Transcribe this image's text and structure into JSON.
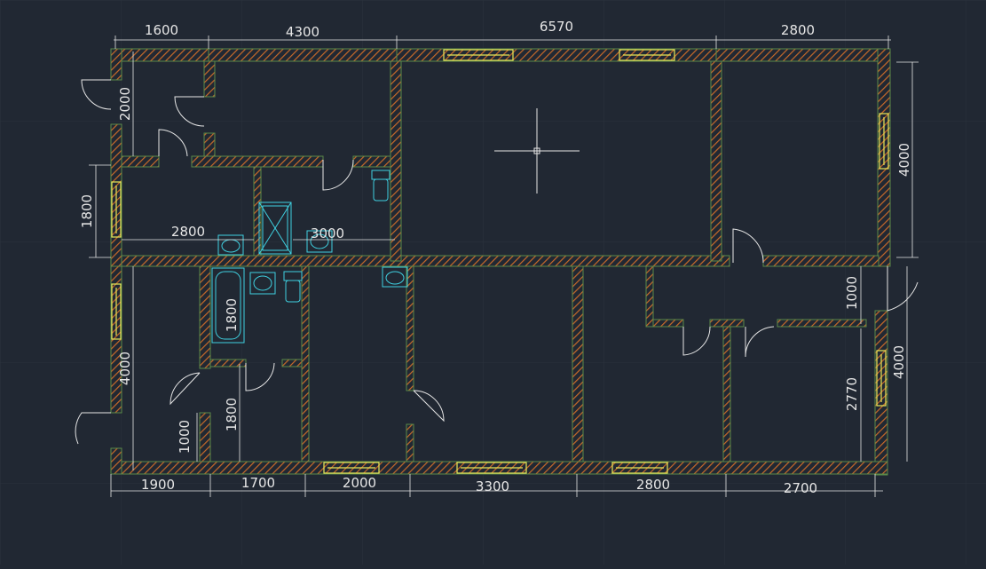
{
  "colors": {
    "background": "#212833",
    "grid": "#2b323d",
    "wall_outline": "#5a8a4a",
    "wall_hatch": "#c86a2a",
    "dimension": "#e6e6e6",
    "window": "#e8e85a",
    "fixture": "#3fd0e0",
    "door": "#e6e6e6",
    "crosshair": "#e6e6e6"
  },
  "dimensions_top": [
    "1600",
    "4300",
    "6570",
    "2800"
  ],
  "dimensions_bottom": [
    "1900",
    "1700",
    "2000",
    "3300",
    "2800",
    "2700"
  ],
  "dimensions_left": [
    "2000",
    "1800",
    "4000",
    "1000"
  ],
  "dimensions_right": [
    "4000",
    "1000",
    "2770",
    "4000"
  ],
  "dimensions_interior": [
    "2800",
    "3000",
    "1800",
    "1800"
  ],
  "icons": [
    "crosshair-icon",
    "bathtub-icon",
    "shower-icon",
    "sink-icon",
    "toilet-icon"
  ]
}
